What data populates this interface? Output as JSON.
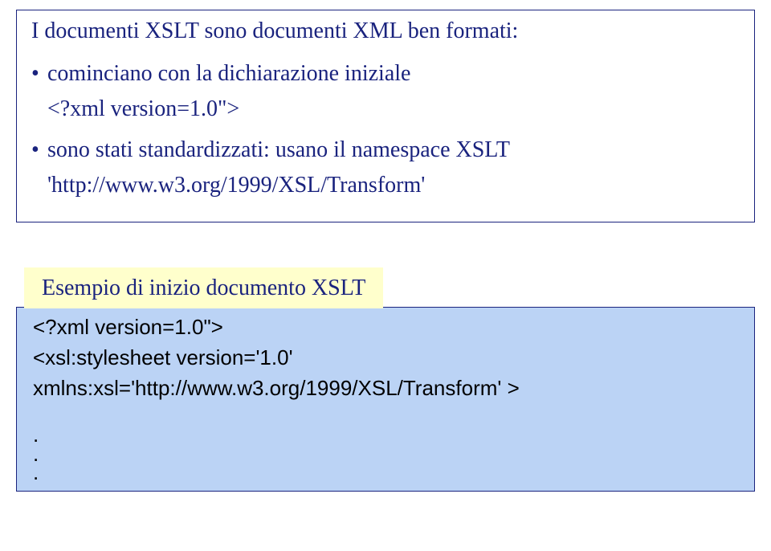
{
  "title": "I documenti XSLT sono documenti XML ben formati:",
  "bullet1": {
    "main": "cominciano con la dichiarazione iniziale",
    "sub": "<?xml version=1.0\">"
  },
  "bullet2": {
    "main": "sono stati standardizzati: usano il namespace XSLT",
    "sub": "'http://www.w3.org/1999/XSL/Transform'"
  },
  "example": {
    "label": "Esempio di inizio documento XSLT",
    "line1": "<?xml version=1.0\">",
    "line2": "<xsl:stylesheet version='1.0'",
    "line3": "xmlns:xsl='http://www.w3.org/1999/XSL/Transform' >",
    "dot1": ".",
    "dot2": ".",
    "dot3": "."
  }
}
